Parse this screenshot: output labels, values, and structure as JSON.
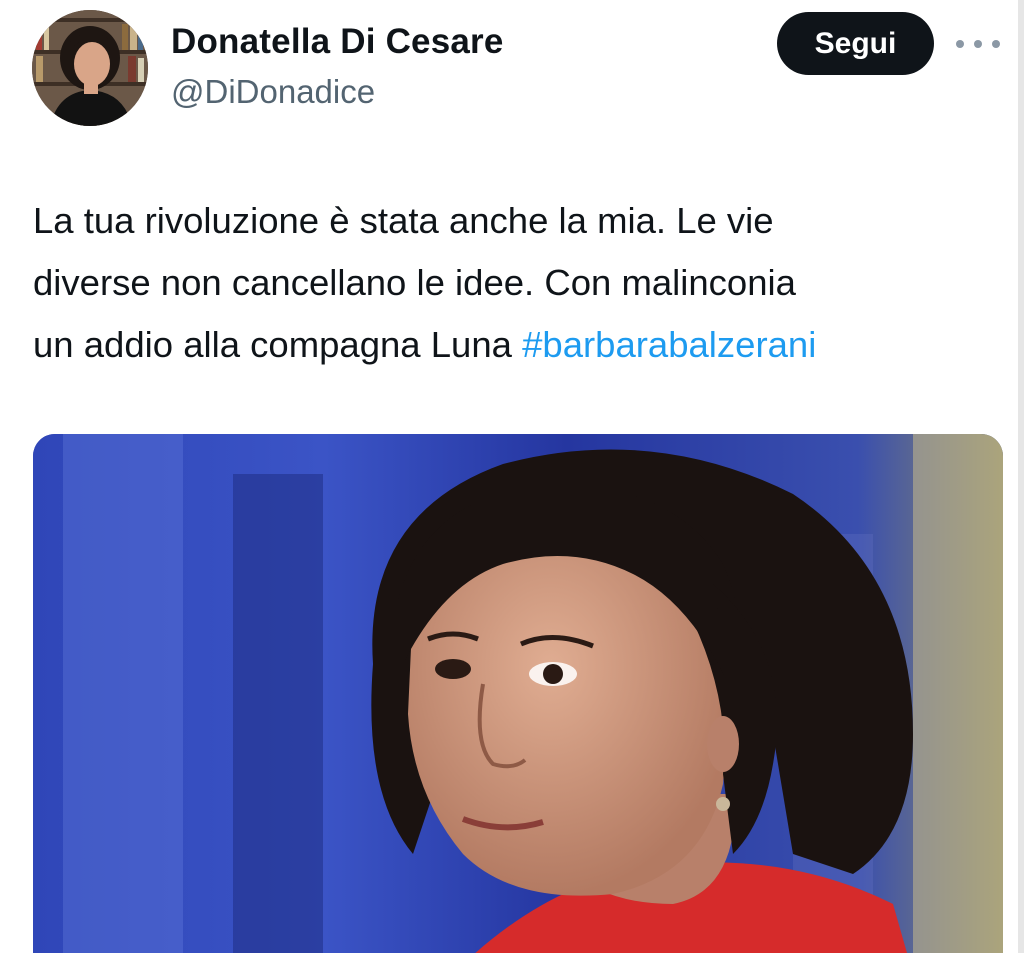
{
  "author": {
    "display_name": "Donatella Di Cesare",
    "handle": "@DiDonadice",
    "avatar_icon": "profile-photo"
  },
  "actions": {
    "follow_label": "Segui",
    "more_icon": "more-horizontal-icon"
  },
  "tweet": {
    "lines": [
      "La tua rivoluzione è stata anche la mia. Le vie",
      "diverse non cancellano le idee. Con malinconia",
      "un addio alla compagna Luna "
    ],
    "hashtag": "#barbarabalzerani"
  },
  "media": {
    "kind": "photo"
  },
  "colors": {
    "text": "#0f1419",
    "secondary": "#536471",
    "link": "#1d9bf0",
    "button_bg": "#0f1419"
  }
}
